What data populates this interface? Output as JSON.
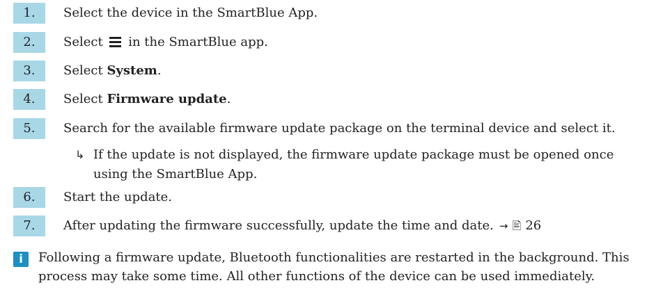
{
  "steps": [
    {
      "num": "1.",
      "text": "Select the device in the SmartBlue App."
    },
    {
      "num": "2.",
      "pre": "Select",
      "icon": "menu-icon",
      "post": "in the SmartBlue app."
    },
    {
      "num": "3.",
      "pre": "Select ",
      "bold": "System",
      "post": "."
    },
    {
      "num": "4.",
      "pre": "Select ",
      "bold": "Firmware update",
      "post": "."
    },
    {
      "num": "5.",
      "text": "Search for the available firmware update package on the terminal device and select it."
    },
    {
      "num": "6.",
      "text": "Start the update."
    },
    {
      "num": "7.",
      "text": "After updating the firmware successfully, update the time and date.",
      "ref_page": "26"
    }
  ],
  "result": {
    "marker": "↳",
    "text": "If the update is not displayed, the firmware update package must be opened once using the SmartBlue App."
  },
  "note": {
    "icon": "info-icon",
    "icon_glyph": "i",
    "text": "Following a firmware update, Bluetooth functionalities are restarted in the background. This process may take some time. All other functions of the device can be used immediately."
  },
  "colors": {
    "step_badge": "#a8d7e6",
    "info_icon": "#1d8fc4",
    "text": "#222222"
  }
}
